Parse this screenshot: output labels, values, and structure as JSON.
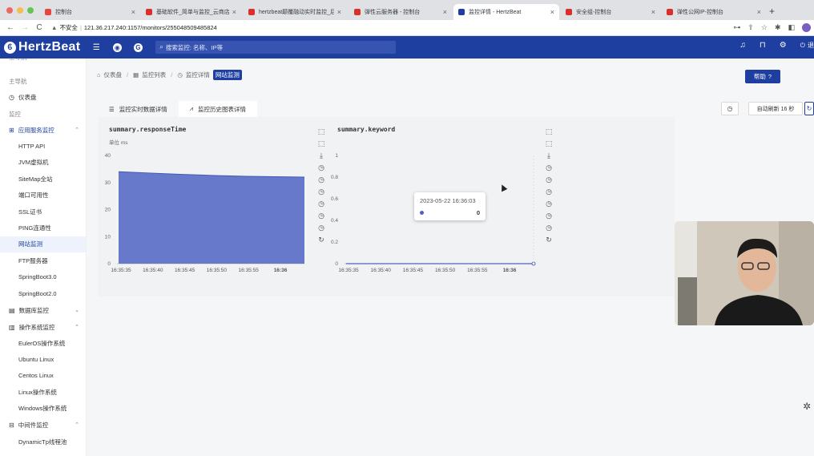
{
  "browser": {
    "tabs": [
      {
        "title": "控制台",
        "fav": "#e8453c"
      },
      {
        "title": "基础软件_简单与监控_云商店-华为",
        "fav": "#d9302c"
      },
      {
        "title": "hertzbeat颠覆融动实时监控_后",
        "fav": "#d9302c"
      },
      {
        "title": "弹性云服务器 - 控制台",
        "fav": "#d9302c"
      },
      {
        "title": "监控详情 - HertzBeat",
        "fav": "#1e3fa0"
      },
      {
        "title": "安全组-控制台",
        "fav": "#d9302c"
      },
      {
        "title": "弹性公网IP-控制台",
        "fav": "#d9302c"
      }
    ],
    "url_warning": "不安全",
    "url": "121.36.217.240:1157/monitors/255048509485824"
  },
  "header": {
    "logo_text": "HertzBeat",
    "search_placeholder": "搜索监控: 名称、IP等",
    "logout_label": "退"
  },
  "sidebar": {
    "partial_top": "主导航",
    "main_nav": "主导航",
    "dashboard": "仪表盘",
    "monitor_group": "监控",
    "app_service": "应用服务监控",
    "app_items": [
      "HTTP API",
      "JVM虚拟机",
      "SiteMap全站",
      "端口可用性",
      "SSL证书",
      "PING连通性",
      "网站监测",
      "FTP服务器",
      "SpringBoot3.0",
      "SpringBoot2.0"
    ],
    "active_item": "网站监测",
    "database": "数据库监控",
    "os_monitor": "操作系统监控",
    "os_items": [
      "EulerOS操作系统",
      "Ubuntu Linux",
      "Centos Linux",
      "Linux操作系统",
      "Windows操作系统"
    ],
    "middleware": "中间件监控",
    "middleware_items": [
      "DynamicTp线程池"
    ]
  },
  "breadcrumb": {
    "home": "仪表盘",
    "list": "监控列表",
    "detail": "监控详情",
    "badge": "网站监测"
  },
  "help_label": "帮助",
  "view_tabs": {
    "realtime": "监控实时数据详情",
    "history": "监控历史图表详情"
  },
  "refresh_label": "自动刷新 16 秒",
  "colors": {
    "brand": "#1e3fa0",
    "series": "#5b6fc7"
  },
  "tooltip": {
    "time": "2023-05-22 16:36:03",
    "value": "0"
  },
  "chart_data": [
    {
      "type": "area",
      "title": "summary.responseTime",
      "unit_label": "单位",
      "unit": "ms",
      "x": [
        "16:35:35",
        "16:35:40",
        "16:35:45",
        "16:35:50",
        "16:35:55",
        "16:36"
      ],
      "ylim": [
        0,
        40
      ],
      "yticks": [
        0,
        10,
        20,
        30,
        40
      ],
      "series": [
        {
          "points": [
            [
              0,
              34
            ],
            [
              1,
              33.5
            ],
            [
              2,
              33
            ],
            [
              3,
              32.6
            ],
            [
              4,
              32.3
            ],
            [
              5.6,
              32
            ]
          ]
        }
      ]
    },
    {
      "type": "line",
      "title": "summary.keyword",
      "x": [
        "16:35:35",
        "16:35:40",
        "16:35:45",
        "16:35:50",
        "16:35:55",
        "16:36"
      ],
      "ylim": [
        0,
        1
      ],
      "yticks": [
        0,
        0.2,
        0.4,
        0.6,
        0.8,
        1
      ],
      "series": [
        {
          "points": [
            [
              0,
              0
            ],
            [
              5.6,
              0
            ]
          ]
        }
      ]
    }
  ]
}
